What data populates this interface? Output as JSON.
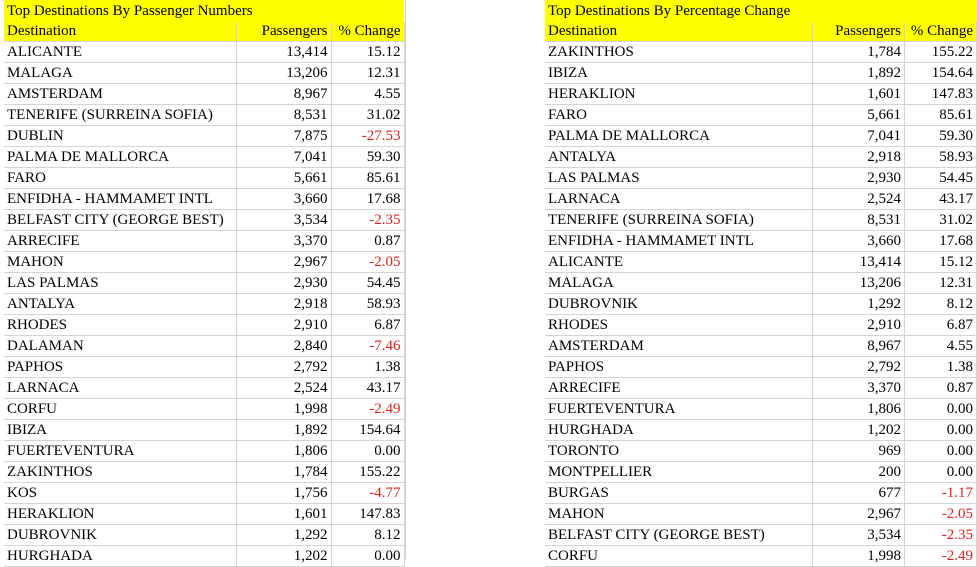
{
  "left": {
    "title": "Top Destinations By Passenger Numbers",
    "headers": [
      "Destination",
      "Passengers",
      "% Change"
    ],
    "rows": [
      [
        "ALICANTE",
        "13,414",
        "15.12"
      ],
      [
        "MALAGA",
        "13,206",
        "12.31"
      ],
      [
        "AMSTERDAM",
        "8,967",
        "4.55"
      ],
      [
        "TENERIFE (SURREINA SOFIA)",
        "8,531",
        "31.02"
      ],
      [
        "DUBLIN",
        "7,875",
        "-27.53"
      ],
      [
        "PALMA DE MALLORCA",
        "7,041",
        "59.30"
      ],
      [
        "FARO",
        "5,661",
        "85.61"
      ],
      [
        "ENFIDHA - HAMMAMET INTL",
        "3,660",
        "17.68"
      ],
      [
        "BELFAST CITY (GEORGE BEST)",
        "3,534",
        "-2.35"
      ],
      [
        "ARRECIFE",
        "3,370",
        "0.87"
      ],
      [
        "MAHON",
        "2,967",
        "-2.05"
      ],
      [
        "LAS PALMAS",
        "2,930",
        "54.45"
      ],
      [
        "ANTALYA",
        "2,918",
        "58.93"
      ],
      [
        "RHODES",
        "2,910",
        "6.87"
      ],
      [
        "DALAMAN",
        "2,840",
        "-7.46"
      ],
      [
        "PAPHOS",
        "2,792",
        "1.38"
      ],
      [
        "LARNACA",
        "2,524",
        "43.17"
      ],
      [
        "CORFU",
        "1,998",
        "-2.49"
      ],
      [
        "IBIZA",
        "1,892",
        "154.64"
      ],
      [
        "FUERTEVENTURA",
        "1,806",
        "0.00"
      ],
      [
        "ZAKINTHOS",
        "1,784",
        "155.22"
      ],
      [
        "KOS",
        "1,756",
        "-4.77"
      ],
      [
        "HERAKLION",
        "1,601",
        "147.83"
      ],
      [
        "DUBROVNIK",
        "1,292",
        "8.12"
      ],
      [
        "HURGHADA",
        "1,202",
        "0.00"
      ]
    ]
  },
  "right": {
    "title": "Top Destinations By Percentage Change",
    "headers": [
      "Destination",
      "Passengers",
      "% Change"
    ],
    "rows": [
      [
        "ZAKINTHOS",
        "1,784",
        "155.22"
      ],
      [
        "IBIZA",
        "1,892",
        "154.64"
      ],
      [
        "HERAKLION",
        "1,601",
        "147.83"
      ],
      [
        "FARO",
        "5,661",
        "85.61"
      ],
      [
        "PALMA DE MALLORCA",
        "7,041",
        "59.30"
      ],
      [
        "ANTALYA",
        "2,918",
        "58.93"
      ],
      [
        "LAS PALMAS",
        "2,930",
        "54.45"
      ],
      [
        "LARNACA",
        "2,524",
        "43.17"
      ],
      [
        "TENERIFE (SURREINA SOFIA)",
        "8,531",
        "31.02"
      ],
      [
        "ENFIDHA - HAMMAMET INTL",
        "3,660",
        "17.68"
      ],
      [
        "ALICANTE",
        "13,414",
        "15.12"
      ],
      [
        "MALAGA",
        "13,206",
        "12.31"
      ],
      [
        "DUBROVNIK",
        "1,292",
        "8.12"
      ],
      [
        "RHODES",
        "2,910",
        "6.87"
      ],
      [
        "AMSTERDAM",
        "8,967",
        "4.55"
      ],
      [
        "PAPHOS",
        "2,792",
        "1.38"
      ],
      [
        "ARRECIFE",
        "3,370",
        "0.87"
      ],
      [
        "FUERTEVENTURA",
        "1,806",
        "0.00"
      ],
      [
        "HURGHADA",
        "1,202",
        "0.00"
      ],
      [
        "TORONTO",
        "969",
        "0.00"
      ],
      [
        "MONTPELLIER",
        "200",
        "0.00"
      ],
      [
        "BURGAS",
        "677",
        "-1.17"
      ],
      [
        "MAHON",
        "2,967",
        "-2.05"
      ],
      [
        "BELFAST CITY (GEORGE BEST)",
        "3,534",
        "-2.35"
      ],
      [
        "CORFU",
        "1,998",
        "-2.49"
      ]
    ]
  },
  "colors": {
    "header_bg": "#ffff00",
    "negative": "#e0201b",
    "gridline": "#d4d4d4"
  }
}
